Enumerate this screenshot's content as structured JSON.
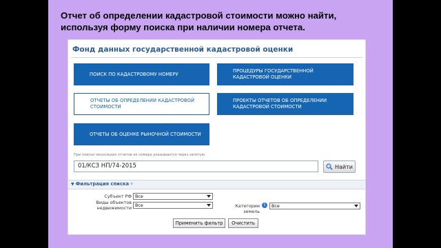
{
  "slide": {
    "caption": "Отчет об определении кадастровой стоимости можно найти, используя форму поиска при наличии номера отчета."
  },
  "panel": {
    "title": "Фонд данных государственной кадастровой оценки",
    "tiles": [
      {
        "label": "ПОИСК ПО КАДАСТРОВОМУ НОМЕРУ"
      },
      {
        "label": "ПРОЦЕДУРЫ ГОСУДАРСТВЕННОЙ КАДАСТРОВОЙ ОЦЕНКИ"
      },
      {
        "label": "ОТЧЕТЫ ОБ ОПРЕДЕЛЕНИИ КАДАСТРОВОЙ СТОИМОСТИ"
      },
      {
        "label": "ПРОЕКТЫ ОТЧЕТОВ ОБ ОПРЕДЕЛЕНИИ КАДАСТРОВОЙ СТОИМОСТИ"
      },
      {
        "label": "ОТЧЕТЫ ОБ ОЦЕНКЕ РЫНОЧНОЙ СТОИМОСТИ"
      }
    ],
    "hint": "При поиске нескольких отчетов их номера указываются через запятую.",
    "search": {
      "value": "01/КСЗ НП/74-2015",
      "button": "Найти"
    },
    "filter": {
      "title": "Фильтрация списка",
      "subject_label": "Субъект РФ",
      "subject_value": "Все",
      "objects_label": "Виды объектов недвижимости",
      "objects_value": "Все",
      "categories_label": "Категории земель",
      "categories_value": "Все",
      "apply": "Применить фильтр",
      "clear": "Очистить"
    }
  },
  "colors": {
    "accent": "#1565b3",
    "slide_bg": "#c9a4f2"
  },
  "icons": [
    "search-icon",
    "info-icon",
    "collapse-icon"
  ]
}
